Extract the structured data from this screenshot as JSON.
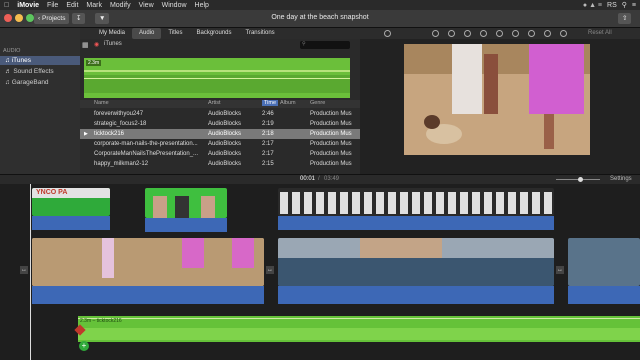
{
  "menubar": {
    "app": "iMovie",
    "items": [
      "File",
      "Edit",
      "Mark",
      "Modify",
      "View",
      "Window",
      "Help"
    ],
    "user": "RS"
  },
  "toolbar": {
    "projects_label": "Projects",
    "title": "One day at the beach snapshot"
  },
  "tabs": [
    "My Media",
    "Audio",
    "Titles",
    "Backgrounds",
    "Transitions"
  ],
  "sidebar": {
    "header": "AUDIO",
    "items": [
      "iTunes",
      "Sound Effects",
      "GarageBand"
    ]
  },
  "browser": {
    "source": "iTunes",
    "preview_duration": "2.3m",
    "columns": [
      "Name",
      "Artist",
      "Time",
      "Album",
      "Genre"
    ],
    "rows": [
      {
        "name": "foreverwithyou247",
        "artist": "AudioBlocks",
        "time": "2:46",
        "album": "",
        "genre": "Production Mus"
      },
      {
        "name": "strategic_focus2-18",
        "artist": "AudioBlocks",
        "time": "2:19",
        "album": "",
        "genre": "Production Mus"
      },
      {
        "name": "ticktock216",
        "artist": "AudioBlocks",
        "time": "2:18",
        "album": "",
        "genre": "Production Mus"
      },
      {
        "name": "corporate-man-nails-the-presentation...",
        "artist": "AudioBlocks",
        "time": "2:17",
        "album": "",
        "genre": "Production Mus"
      },
      {
        "name": "CorporateManNailsThePresentation_...",
        "artist": "AudioBlocks",
        "time": "2:17",
        "album": "",
        "genre": "Production Mus"
      },
      {
        "name": "happy_milkman2-12",
        "artist": "AudioBlocks",
        "time": "2:15",
        "album": "",
        "genre": "Production Mus"
      }
    ],
    "selected_index": 2
  },
  "viewer": {
    "reset_all": "Reset All"
  },
  "timeline": {
    "timecode": "00:01",
    "total": "03:49",
    "settings_label": "Settings",
    "music_label": "2.3m – ticktock216",
    "title_clip_text": "YNCO PA"
  },
  "colors": {
    "accent_blue": "#3d68b6",
    "music_green": "#65c239",
    "title_green": "#2faa3a"
  }
}
